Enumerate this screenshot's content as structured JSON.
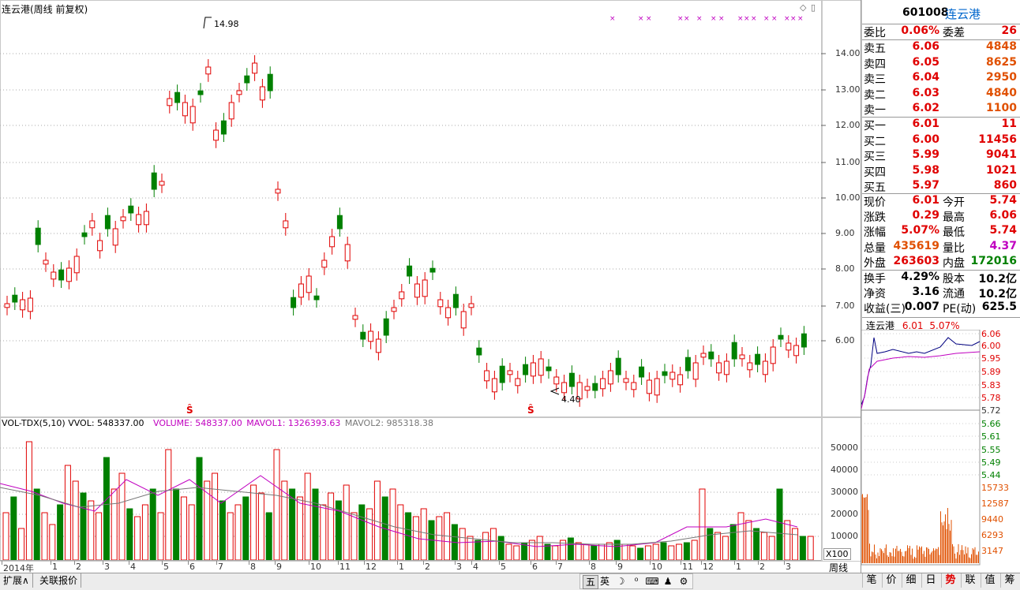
{
  "header": {
    "title": "连云港(周线 前复权)",
    "max_label": "14.98",
    "min_label": "4.40"
  },
  "price_axis": [
    "14.00",
    "13.00",
    "12.00",
    "11.00",
    "10.00",
    "9.00",
    "8.00",
    "7.00",
    "6.00"
  ],
  "volume_header": {
    "indicator": "VOL-TDX(5,10)",
    "vvol": "VVOL: 548337.00",
    "volume": "VOLUME: 548337.00",
    "mavol1": "MAVOL1: 1326393.63",
    "mavol2": "MAVOL2: 985318.38"
  },
  "volume_axis": [
    "50000",
    "40000",
    "30000",
    "20000",
    "10000"
  ],
  "volume_unit": "X100",
  "time_axis": [
    "2014年",
    "1",
    "2",
    "3",
    "4",
    "5",
    "6",
    "7",
    "8",
    "9",
    "10",
    "11",
    "12",
    "1",
    "2",
    "3",
    "4",
    "5",
    "6",
    "7",
    "8",
    "9",
    "10",
    "11",
    "12",
    "1",
    "2",
    "3"
  ],
  "period_label": "周线",
  "bottom_tabs": [
    "扩展∧",
    "关联报价"
  ],
  "ime_buttons": [
    "五",
    "英",
    "☽",
    "⁰",
    "⌨",
    "♟",
    "⚙"
  ],
  "side_tabs": [
    "笔",
    "价",
    "细",
    "日",
    "势",
    "联",
    "值",
    "筹"
  ],
  "quote": {
    "code": "601008",
    "name": "连云港",
    "weibi_label": "委比",
    "weibi": "0.06%",
    "weicha_label": "委差",
    "weicha": "26",
    "sells": [
      {
        "label": "卖五",
        "price": "6.06",
        "vol": "4848"
      },
      {
        "label": "卖四",
        "price": "6.05",
        "vol": "8625"
      },
      {
        "label": "卖三",
        "price": "6.04",
        "vol": "2950"
      },
      {
        "label": "卖二",
        "price": "6.03",
        "vol": "4840"
      },
      {
        "label": "卖一",
        "price": "6.02",
        "vol": "1100"
      }
    ],
    "buys": [
      {
        "label": "买一",
        "price": "6.01",
        "vol": "11"
      },
      {
        "label": "买二",
        "price": "6.00",
        "vol": "11456"
      },
      {
        "label": "买三",
        "price": "5.99",
        "vol": "9041"
      },
      {
        "label": "买四",
        "price": "5.98",
        "vol": "1021"
      },
      {
        "label": "买五",
        "price": "5.97",
        "vol": "860"
      }
    ],
    "stats": [
      {
        "l1": "现价",
        "v1": "6.01",
        "l2": "今开",
        "v2": "5.74"
      },
      {
        "l1": "涨跌",
        "v1": "0.29",
        "l2": "最高",
        "v2": "6.06"
      },
      {
        "l1": "涨幅",
        "v1": "5.07%",
        "l2": "最低",
        "v2": "5.74"
      },
      {
        "l1": "总量",
        "v1": "435619",
        "l2": "量比",
        "v2": "4.37"
      },
      {
        "l1": "外盘",
        "v1": "263603",
        "l2": "内盘",
        "v2": "172016"
      }
    ],
    "stats2": [
      {
        "l1": "换手",
        "v1": "4.29%",
        "l2": "股本",
        "v2": "10.2亿"
      },
      {
        "l1": "净资",
        "v1": "3.16",
        "l2": "流通",
        "v2": "10.2亿"
      },
      {
        "l1": "收益(三)",
        "v1": "0.007",
        "l2": "PE(动)",
        "v2": "625.5"
      }
    ]
  },
  "mini_chart": {
    "name": "连云港",
    "price": "6.01",
    "change": "5.07%",
    "price_axis": [
      "6.06",
      "6.00",
      "5.95",
      "5.89",
      "5.83",
      "5.78",
      "5.72",
      "5.66",
      "5.61",
      "5.55",
      "5.49",
      "5.44"
    ],
    "vol_axis": [
      "15733",
      "12587",
      "9440",
      "6293",
      "3147"
    ]
  }
}
